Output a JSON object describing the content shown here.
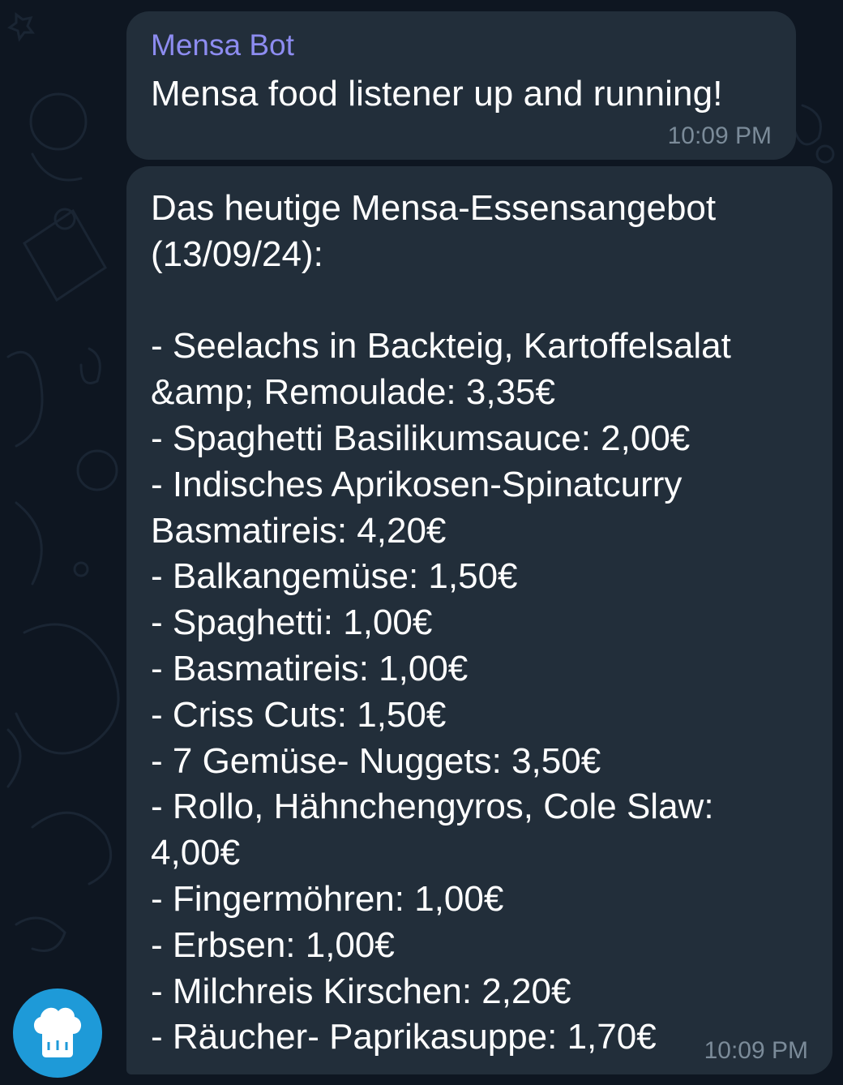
{
  "colors": {
    "background": "#0e1621",
    "bubble": "#222e3a",
    "sender_name": "#8d8cf0",
    "timestamp": "#7b8b99",
    "avatar": "#1e9ad8"
  },
  "messages": [
    {
      "sender": "Mensa Bot",
      "text": "Mensa food listener up and running!",
      "time": "10:09 PM"
    },
    {
      "lines": [
        "Das heutige Mensa-Essensangebot",
        "(13/09/24):",
        "",
        "- Seelachs in Backteig, Kartoffelsalat",
        "&amp; Remoulade: 3,35€",
        "- Spaghetti Basilikumsauce: 2,00€",
        "- Indisches Aprikosen-Spinatcurry",
        "Basmatireis: 4,20€",
        "- Balkangemüse: 1,50€",
        "- Spaghetti: 1,00€",
        "- Basmatireis: 1,00€",
        "- Criss Cuts: 1,50€",
        "- 7 Gemüse- Nuggets: 3,50€",
        "- Rollo, Hähnchengyros, Cole Slaw:",
        "4,00€",
        "- Fingermöhren: 1,00€",
        "- Erbsen: 1,00€",
        "- Milchreis Kirschen: 2,20€",
        "- Räucher- Paprikasuppe: 1,70€"
      ],
      "time": "10:09 PM"
    }
  ],
  "avatar": {
    "icon": "chef-hat-icon"
  }
}
